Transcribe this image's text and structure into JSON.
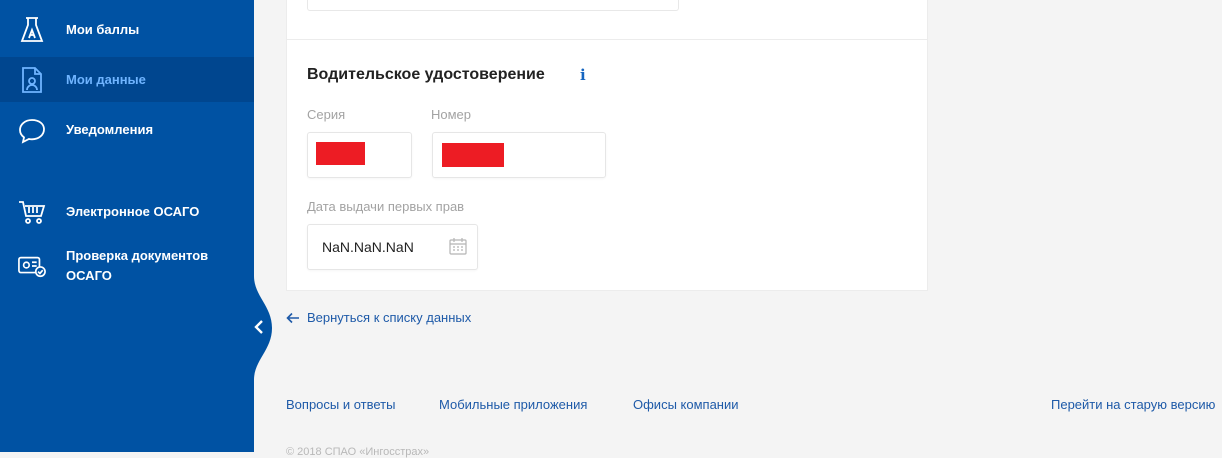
{
  "sidebar": {
    "items": [
      {
        "label": "Мои баллы",
        "icon": "flask-icon"
      },
      {
        "label": "Мои данные",
        "icon": "user-document-icon"
      },
      {
        "label": "Уведомления",
        "icon": "chat-bubble-icon"
      },
      {
        "label": "Электронное ОСАГО",
        "icon": "shopping-cart-icon"
      },
      {
        "label": "Проверка документов ОСАГО",
        "icon": "document-check-icon"
      }
    ]
  },
  "driver_license": {
    "title": "Водительское удостоверение",
    "info_label": "i",
    "series_label": "Серия",
    "number_label": "Номер",
    "issue_date_label": "Дата выдачи первых прав",
    "issue_date_value": "NaN.NaN.NaN"
  },
  "back_link": "Вернуться к списку данных",
  "footer": {
    "links": [
      "Вопросы и ответы",
      "Мобильные приложения",
      "Офисы компании"
    ],
    "old_version": "Перейти на старую версию",
    "copyright": "© 2018 СПАО «Ингосстрах»"
  },
  "colors": {
    "sidebar_bg": "#0052a3",
    "sidebar_active_bg": "#00468f",
    "active_text": "#6fb4ff",
    "link": "#1e5aa8",
    "redaction": "#ed1c24"
  }
}
